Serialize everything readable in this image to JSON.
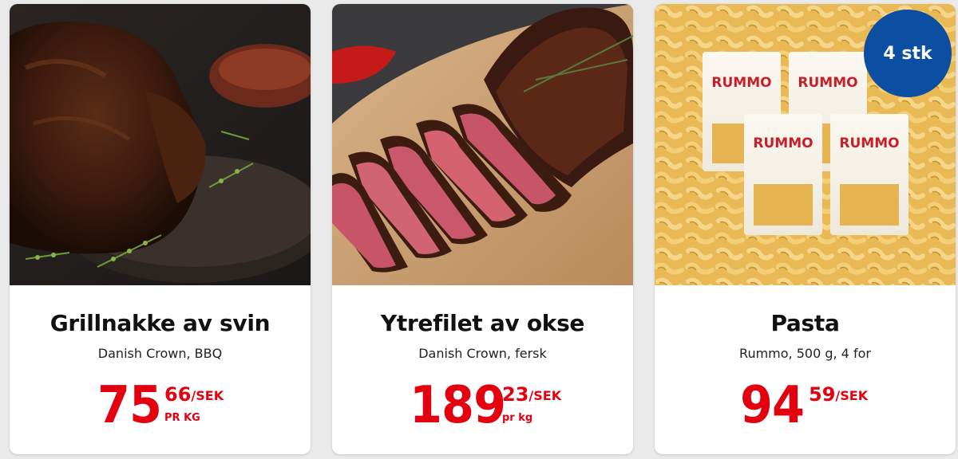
{
  "products": [
    {
      "title": "Grillnakke av svin",
      "subtitle": "Danish Crown, BBQ",
      "price_main": "75",
      "price_dec": "66",
      "price_currency": "/SEK",
      "price_unit": "PR KG",
      "image_icon": "roast-pork-photo"
    },
    {
      "title": "Ytrefilet av okse",
      "subtitle": "Danish Crown, fersk",
      "price_main": "189",
      "price_dec": "23",
      "price_currency": "/SEK",
      "price_unit": "pr kg",
      "image_icon": "sliced-steak-photo"
    },
    {
      "title": "Pasta",
      "subtitle": "Rummo, 500 g, 4 for",
      "price_main": "94",
      "price_dec": "59",
      "price_currency": "/SEK",
      "price_unit": "",
      "badge": "4 stk",
      "image_icon": "pasta-packages-photo",
      "package_brand": "RUMMO"
    }
  ],
  "colors": {
    "price_red": "#e3000f",
    "badge_blue": "#0b4ea2",
    "card_bg": "#ffffff",
    "page_bg": "#eaeaea"
  }
}
